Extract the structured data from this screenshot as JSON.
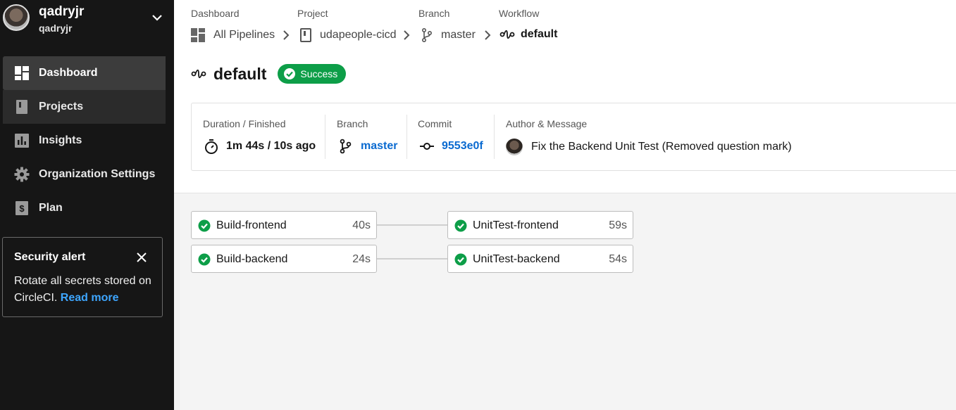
{
  "user": {
    "name": "qadryjr",
    "org": "qadryjr"
  },
  "sidebar": {
    "items": [
      {
        "label": "Dashboard",
        "icon": "dashboard-icon"
      },
      {
        "label": "Projects",
        "icon": "book-icon"
      },
      {
        "label": "Insights",
        "icon": "bar-chart-icon"
      },
      {
        "label": "Organization Settings",
        "icon": "gear-icon"
      },
      {
        "label": "Plan",
        "icon": "dollar-icon"
      }
    ]
  },
  "alert": {
    "title": "Security alert",
    "body": "Rotate all secrets stored on CircleCI.",
    "link": "Read more"
  },
  "breadcrumb": {
    "dashboard": {
      "label": "Dashboard",
      "value": "All Pipelines"
    },
    "project": {
      "label": "Project",
      "value": "udapeople-cicd"
    },
    "branch": {
      "label": "Branch",
      "value": "master"
    },
    "workflow": {
      "label": "Workflow",
      "value": "default"
    }
  },
  "workflow": {
    "title": "default",
    "status": "Success",
    "status_color": "#0d9e48"
  },
  "info": {
    "duration": {
      "label": "Duration / Finished",
      "value": "1m 44s / 10s ago"
    },
    "branch": {
      "label": "Branch",
      "value": "master"
    },
    "commit": {
      "label": "Commit",
      "value": "9553e0f"
    },
    "author": {
      "label": "Author & Message",
      "value": "Fix the Backend Unit Test (Removed question mark)"
    }
  },
  "jobs": [
    {
      "name": "Build-frontend",
      "duration": "40s"
    },
    {
      "name": "Build-backend",
      "duration": "24s"
    },
    {
      "name": "UnitTest-frontend",
      "duration": "59s"
    },
    {
      "name": "UnitTest-backend",
      "duration": "54s"
    }
  ]
}
